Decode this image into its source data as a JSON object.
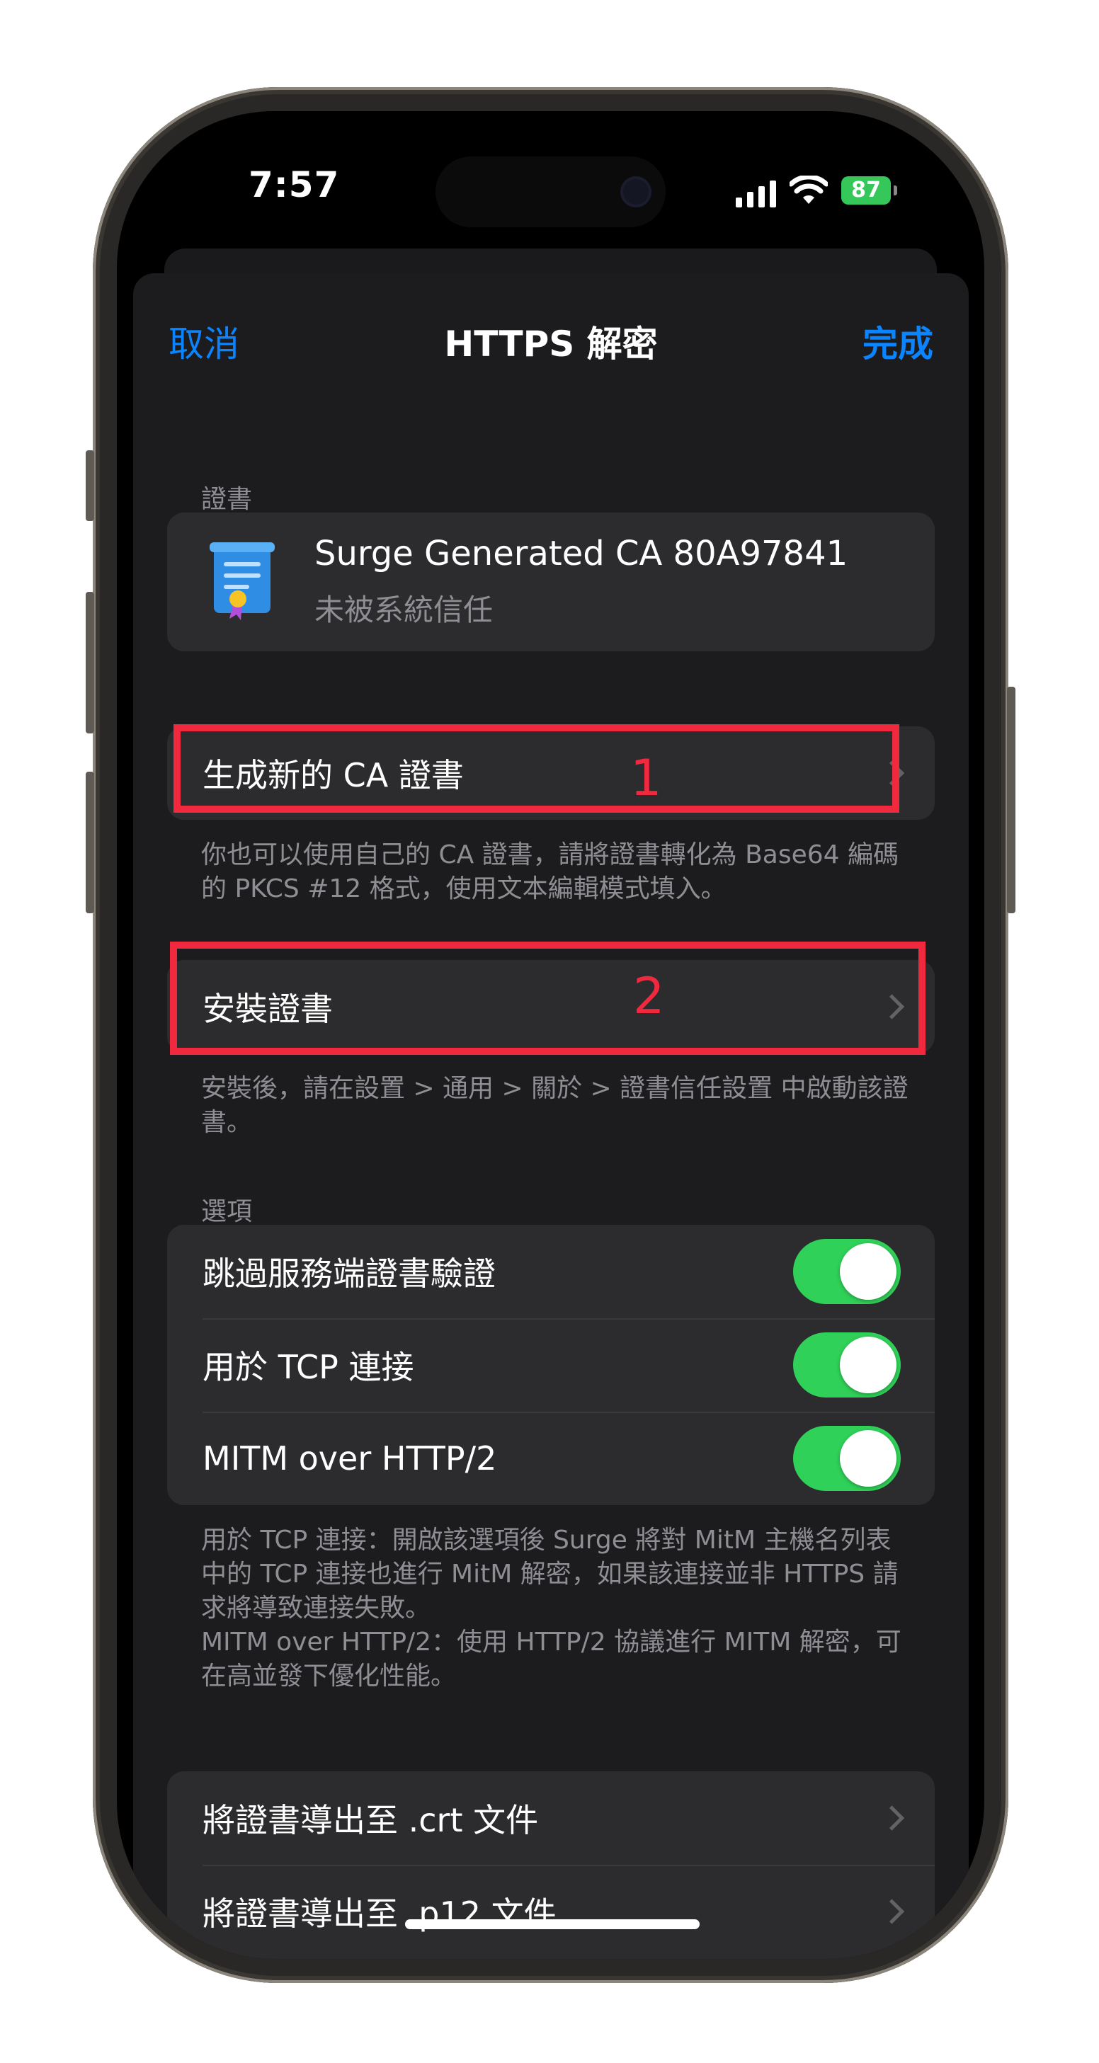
{
  "status": {
    "time": "7:57",
    "battery": "87"
  },
  "nav": {
    "cancel": "取消",
    "title": "HTTPS 解密",
    "done": "完成"
  },
  "certificate_section": {
    "header": "證書",
    "name": "Surge Generated CA 80A97841",
    "status": "未被系統信任"
  },
  "generate_ca": {
    "label": "生成新的 CA 證書",
    "footnote": "你也可以使用自己的 CA 證書，請將證書轉化為 Base64 編碼的 PKCS #12 格式，使用文本編輯模式填入。"
  },
  "install_cert": {
    "label": "安裝證書",
    "footnote": "安裝後，請在設置 > 通用 > 關於 > 證書信任設置 中啟動該證書。"
  },
  "options": {
    "header": "選項",
    "items": [
      {
        "label": "跳過服務端證書驗證",
        "enabled": true
      },
      {
        "label": "用於 TCP 連接",
        "enabled": true
      },
      {
        "label": "MITM over HTTP/2",
        "enabled": true
      }
    ],
    "footnote_1": "用於 TCP 連接：開啟該選項後 Surge 將對 MitM 主機名列表中的 TCP 連接也進行 MitM 解密，如果該連接並非 HTTPS 請求將導致連接失敗。",
    "footnote_2": "MITM over HTTP/2：使用 HTTP/2 協議進行 MITM 解密，可在高並發下優化性能。"
  },
  "export": {
    "items": [
      {
        "label": "將證書導出至 .crt 文件"
      },
      {
        "label": "將證書導出至 .p12 文件"
      }
    ]
  },
  "annotations": {
    "first": "1",
    "second": "2"
  },
  "colors": {
    "accent": "#0a84ff",
    "toggle_on": "#30d158",
    "annotation": "#f0293f",
    "sheet_bg": "#1c1c1e",
    "cell_bg": "#2c2c2e"
  }
}
